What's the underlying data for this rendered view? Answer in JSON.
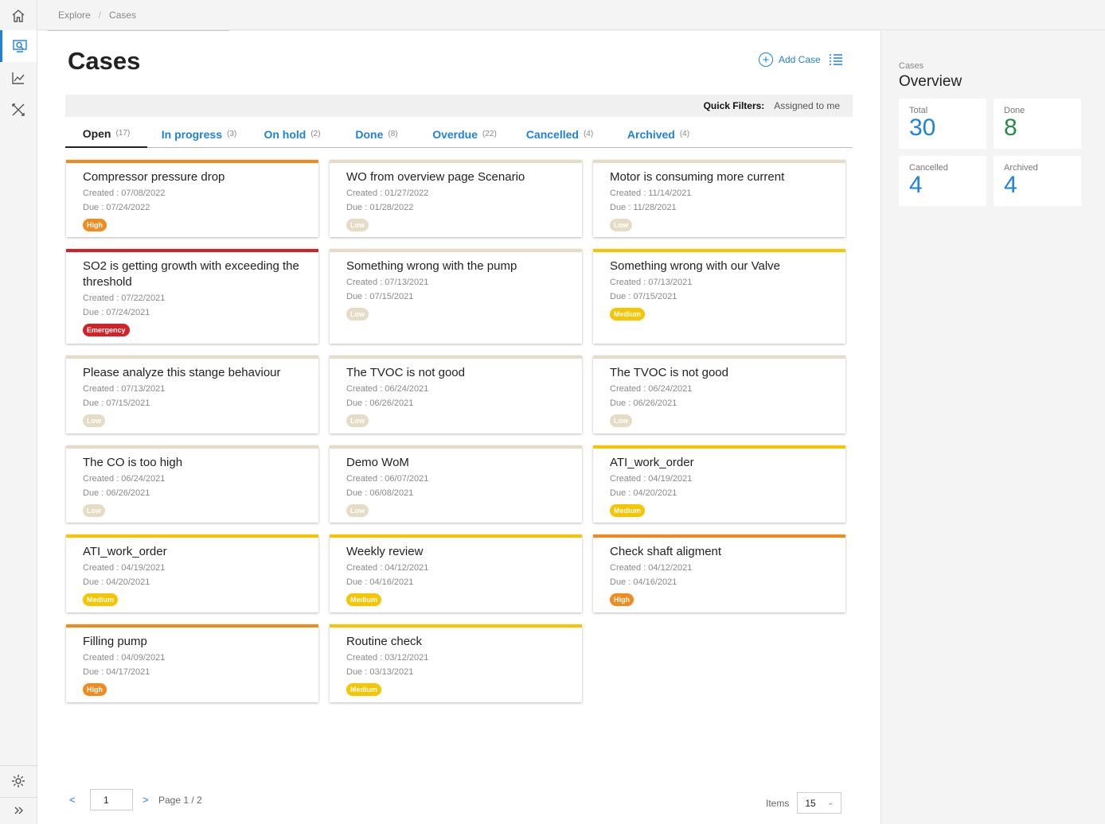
{
  "breadcrumb": [
    "Explore",
    "Cases"
  ],
  "page": {
    "title": "Cases",
    "add_label": "Add Case"
  },
  "quick_filters": {
    "label": "Quick Filters:",
    "value": "Assigned to me"
  },
  "tabs": [
    {
      "label": "Open",
      "count": "(17)"
    },
    {
      "label": "In progress",
      "count": "(3)"
    },
    {
      "label": "On hold",
      "count": "(2)"
    },
    {
      "label": "Done",
      "count": "(8)"
    },
    {
      "label": "Overdue",
      "count": "(22)"
    },
    {
      "label": "Cancelled",
      "count": "(4)"
    },
    {
      "label": "Archived",
      "count": "(4)"
    }
  ],
  "cases": [
    {
      "title": "Compressor pressure drop",
      "created": "Created : 07/08/2022",
      "due": "Due : 07/24/2022",
      "priority": "High"
    },
    {
      "title": "WO from overview page Scenario",
      "created": "Created : 01/27/2022",
      "due": "Due : 01/28/2022",
      "priority": "Low"
    },
    {
      "title": "Motor is consuming more current",
      "created": "Created : 11/14/2021",
      "due": "Due : 11/28/2021",
      "priority": "Low"
    },
    {
      "title": "SO2 is getting growth with exceeding the threshold",
      "created": "Created : 07/22/2021",
      "due": "Due : 07/24/2021",
      "priority": "Emergency"
    },
    {
      "title": "Something wrong with the pump",
      "created": "Created : 07/13/2021",
      "due": "Due : 07/15/2021",
      "priority": "Low"
    },
    {
      "title": "Something wrong with our Valve",
      "created": "Created : 07/13/2021",
      "due": "Due : 07/15/2021",
      "priority": "Medium"
    },
    {
      "title": "Please analyze this stange behaviour",
      "created": "Created : 07/13/2021",
      "due": "Due : 07/15/2021",
      "priority": "Low"
    },
    {
      "title": "The TVOC is not good",
      "created": "Created : 06/24/2021",
      "due": "Due : 06/26/2021",
      "priority": "Low"
    },
    {
      "title": "The TVOC is not good",
      "created": "Created : 06/24/2021",
      "due": "Due : 06/26/2021",
      "priority": "Low"
    },
    {
      "title": "The CO is too high",
      "created": "Created : 06/24/2021",
      "due": "Due : 06/26/2021",
      "priority": "Low"
    },
    {
      "title": "Demo WoM",
      "created": "Created : 06/07/2021",
      "due": "Due : 06/08/2021",
      "priority": "Low"
    },
    {
      "title": "ATI_work_order",
      "created": "Created : 04/19/2021",
      "due": "Due : 04/20/2021",
      "priority": "Medium"
    },
    {
      "title": "ATI_work_order",
      "created": "Created : 04/19/2021",
      "due": "Due : 04/20/2021",
      "priority": "Medium"
    },
    {
      "title": "Weekly review",
      "created": "Created : 04/12/2021",
      "due": "Due : 04/16/2021",
      "priority": "Medium"
    },
    {
      "title": "Check shaft aligment",
      "created": "Created : 04/12/2021",
      "due": "Due : 04/16/2021",
      "priority": "High"
    },
    {
      "title": "Filling pump",
      "created": "Created : 04/09/2021",
      "due": "Due : 04/17/2021",
      "priority": "High"
    },
    {
      "title": "Routine check",
      "created": "Created : 03/12/2021",
      "due": "Due : 03/13/2021",
      "priority": "Medium"
    }
  ],
  "priority_colors": {
    "High": "#f28a1e",
    "Low": "#e6dcc5",
    "Medium": "#f7c400",
    "Emergency": "#d61f26"
  },
  "pagination": {
    "prev": "<",
    "next": ">",
    "page_input": "1",
    "page_text": "Page 1 / 2",
    "items_label": "Items",
    "items_value": "15"
  },
  "overview": {
    "subtitle": "Cases",
    "title": "Overview",
    "stats": [
      {
        "label": "Total",
        "value": "30",
        "color": "#1e82d8"
      },
      {
        "label": "Done",
        "value": "8",
        "color": "#2a8a4a"
      },
      {
        "label": "Cancelled",
        "value": "4",
        "color": "#1e82d8"
      },
      {
        "label": "Archived",
        "value": "4",
        "color": "#1e82d8"
      }
    ]
  },
  "icons": [
    "home-icon",
    "explore-icon",
    "chart-icon",
    "tools-icon",
    "settings-icon",
    "expand-icon",
    "add-circle-icon",
    "list-view-icon",
    "chevron-down-icon"
  ]
}
